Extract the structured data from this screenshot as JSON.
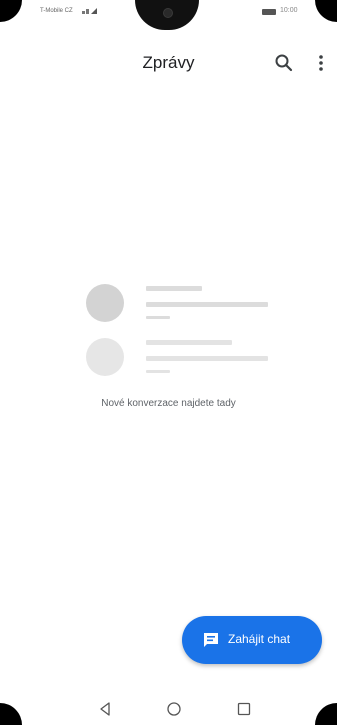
{
  "status_bar": {
    "carrier": "T-Mobile CZ",
    "time": "10:00"
  },
  "app_bar": {
    "title": "Zprávy",
    "search_icon": "search-icon",
    "more_icon": "more-vert-icon"
  },
  "empty_state": {
    "message": "Nové konverzace najdete tady"
  },
  "fab": {
    "label": "Zahájit chat",
    "icon": "chat-bubble-icon"
  },
  "navigation": {
    "back_icon": "back-triangle-icon",
    "home_icon": "home-circle-icon",
    "recents_icon": "recents-square-icon"
  },
  "colors": {
    "accent": "#1a73e8",
    "placeholder_avatar_1": "#d3d3d3",
    "placeholder_avatar_2": "#e6e6e6",
    "placeholder_line": "#dcdcdc"
  }
}
